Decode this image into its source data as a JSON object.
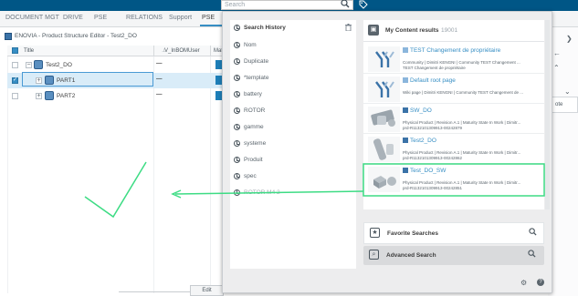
{
  "search": {
    "placeholder": "Search"
  },
  "tabs": [
    "DOCUMENT MGT",
    "DRIVE",
    "PSE",
    "RELATIONS",
    "Support",
    "PSE"
  ],
  "editor": {
    "title": "ENOVIA - Product Structure Editor - Test2_DO",
    "columns": {
      "title": "Title",
      "owner": "V_InBOMUser",
      "material": "Mat"
    },
    "rows": [
      {
        "label": "Test2_DO",
        "owner": "—",
        "expander": "−"
      },
      {
        "label": "PART1",
        "owner": "—",
        "expander": "+"
      },
      {
        "label": "PART2",
        "owner": "—",
        "expander": "+"
      }
    ],
    "edit_tab": "Edit"
  },
  "right": {
    "field_label": "ote"
  },
  "history": {
    "title": "Search History",
    "items": [
      "Nom",
      "Duplicate",
      "*template",
      "battery",
      "ROTOR",
      "gamme",
      "systeme",
      "Produit",
      "spec",
      "ROTOR M4 2"
    ]
  },
  "results": {
    "title": "My Content results",
    "count": "19001",
    "items": [
      {
        "title": "TEST Changement de propriétaire",
        "line1": "Community | Dimitri KENGNI | Community TEST Changement ...",
        "line2": "TEST Changement de propriétaire",
        "thumb": "y-logo"
      },
      {
        "title": "Default root page",
        "line1": "Wiki page | Dimitri KENGNI | Community TEST Changement de ...",
        "line2": "",
        "thumb": "y-logo"
      },
      {
        "title": "SW_DO",
        "line1": "Physical Product | Revision A.1 | Maturity State In Work | Dimitr...",
        "line2": "prd-R1132101309913-00242879",
        "thumb": "part"
      },
      {
        "title": "Test2_DO",
        "line1": "Physical Product | Revision A.1 | Maturity State In Work | Dimitr...",
        "line2": "prd-R1132101309913-00242862",
        "thumb": "part2"
      },
      {
        "title": "Test_DO_SW",
        "line1": "Physical Product | Revision A.1 | Maturity State In Work | Dimitr...",
        "line2": "prd-R1132101309913-00242851",
        "thumb": "part3"
      }
    ]
  },
  "actions": {
    "favorite": "Favorite Searches",
    "advanced": "Advanced Search"
  },
  "colors": {
    "accent": "#368ec4",
    "annotation": "#3ddc84",
    "topbar": "#005686"
  },
  "icons": [
    "search-icon",
    "tag-icon",
    "trash-icon",
    "clock-icon",
    "star-icon",
    "advanced-search-icon",
    "gear-icon",
    "help-icon"
  ]
}
